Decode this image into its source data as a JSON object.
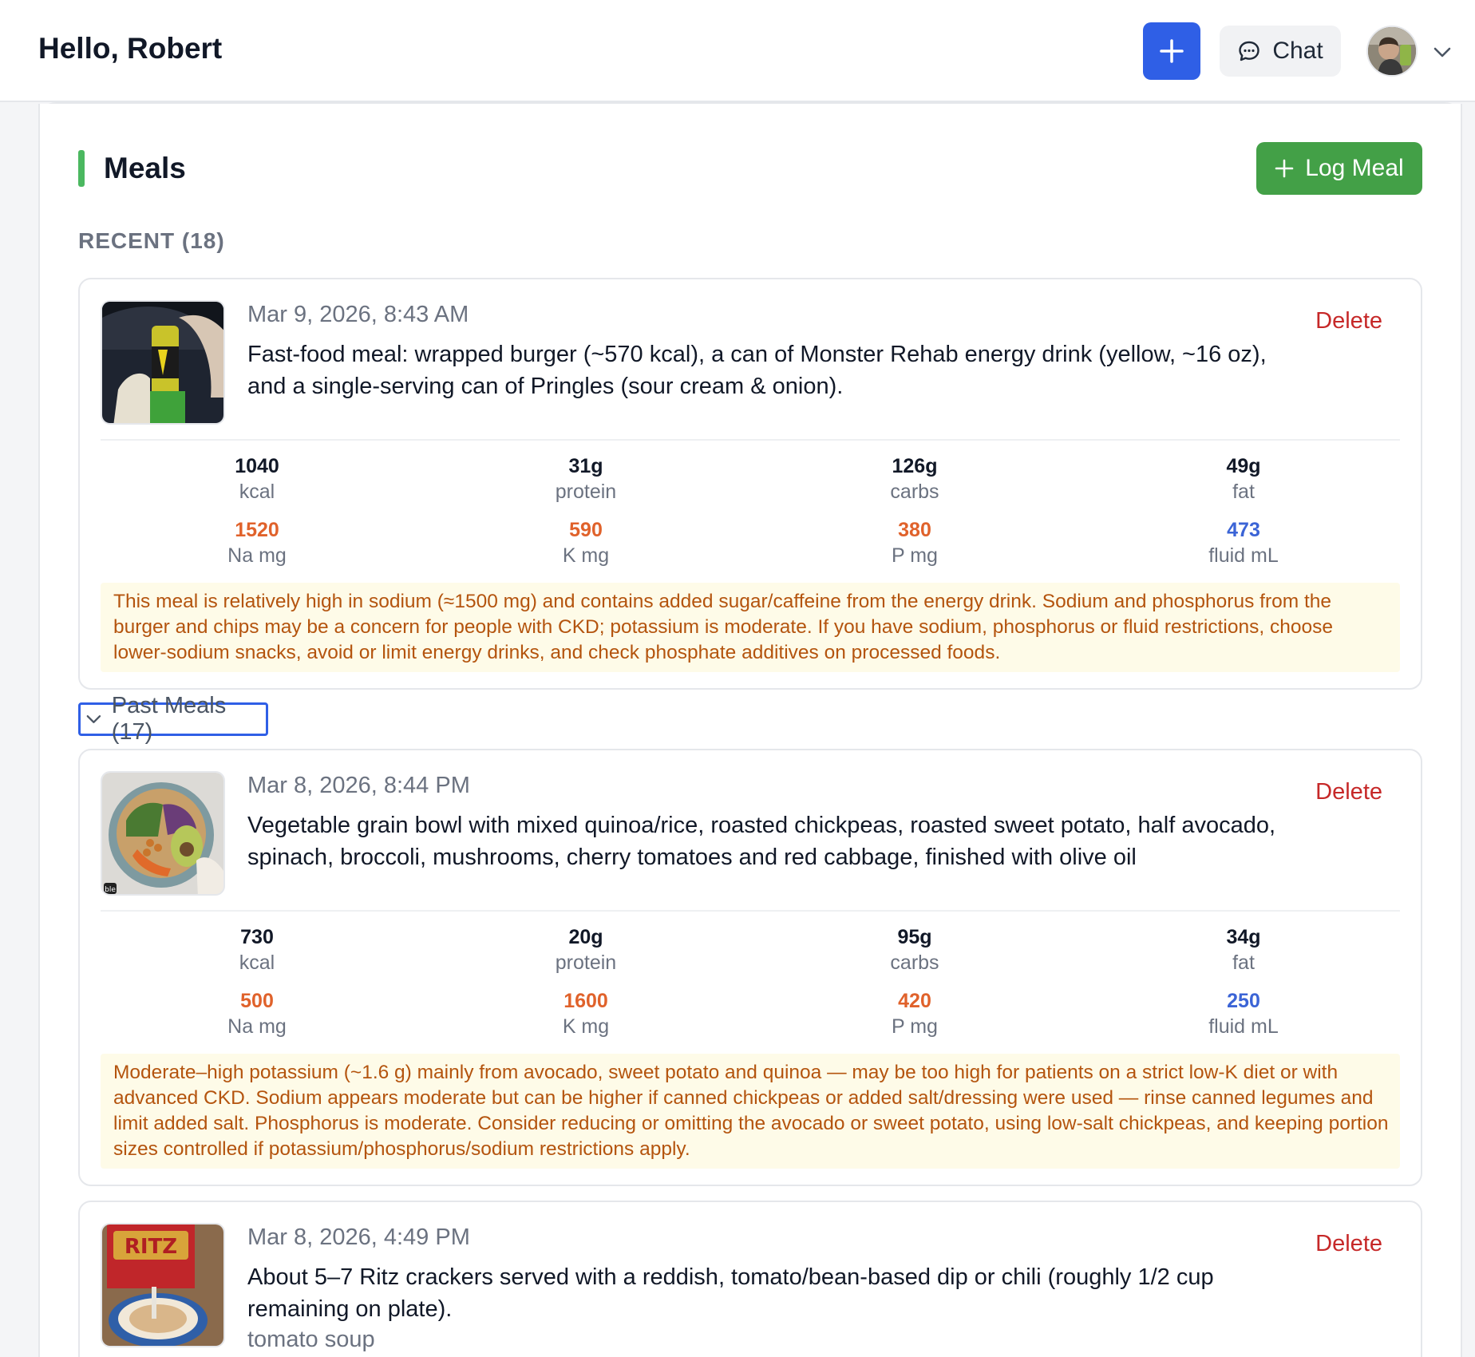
{
  "header": {
    "greeting": "Hello, Robert",
    "add_icon": "plus-icon",
    "chat_label": "Chat",
    "chat_icon": "chat-bubble-icon",
    "menu_icon": "chevron-down-icon"
  },
  "meals": {
    "title": "Meals",
    "log_button": "Log Meal",
    "recent_label": "RECENT (18)",
    "past_toggle": "Past Meals (17)",
    "delete_label": "Delete",
    "nutrient_labels": {
      "kcal": "kcal",
      "protein": "protein",
      "carbs": "carbs",
      "fat": "fat",
      "na": "Na mg",
      "k": "K mg",
      "p": "P mg",
      "fluid": "fluid mL"
    },
    "recent": [
      {
        "time": "Mar 9, 2026, 8:43 AM",
        "description": "Fast-food meal: wrapped burger (~570 kcal), a can of Monster Rehab energy drink (yellow, ~16 oz), and a single-serving can of Pringles (sour cream & onion).",
        "kcal": "1040",
        "protein": "31g",
        "carbs": "126g",
        "fat": "49g",
        "na": "1520",
        "k": "590",
        "p": "380",
        "fluid": "473",
        "alert": "This meal is relatively high in sodium (≈1500 mg) and contains added sugar/caffeine from the energy drink. Sodium and phosphorus from the burger and chips may be a concern for people with CKD; potassium is moderate. If you have sodium, phosphorus or fluid restrictions, choose lower-sodium snacks, avoid or limit energy drinks, and check phosphate additives on processed foods."
      }
    ],
    "past": [
      {
        "time": "Mar 8, 2026, 8:44 PM",
        "description": "Vegetable grain bowl with mixed quinoa/rice, roasted chickpeas, roasted sweet potato, half avocado, spinach, broccoli, mushrooms, cherry tomatoes and red cabbage, finished with olive oil",
        "thumb_badge": "ble",
        "kcal": "730",
        "protein": "20g",
        "carbs": "95g",
        "fat": "34g",
        "na": "500",
        "k": "1600",
        "p": "420",
        "fluid": "250",
        "alert": "Moderate–high potassium (~1.6 g) mainly from avocado, sweet potato and quinoa — may be too high for patients on a strict low-K diet or with advanced CKD. Sodium appears moderate but can be higher if canned chickpeas or added salt/dressing were used — rinse canned legumes and limit added salt. Phosphorus is moderate. Consider reducing or omitting the avocado or sweet potato, using low-salt chickpeas, and keeping portion sizes controlled if potassium/phosphorus/sodium restrictions apply."
      },
      {
        "time": "Mar 8, 2026, 4:49 PM",
        "description": "About 5–7 Ritz crackers served with a reddish, tomato/bean-based dip or chili (roughly 1/2 cup remaining on plate).",
        "note": "tomato soup",
        "thumb_text": "RITZ"
      }
    ]
  },
  "colors": {
    "primary": "#2f5fe6",
    "success": "#43a047",
    "danger": "#c62828",
    "warn_value": "#e0622b",
    "info_value": "#3b64d6",
    "alert_bg": "#fefbe8",
    "alert_text": "#b4540e"
  }
}
